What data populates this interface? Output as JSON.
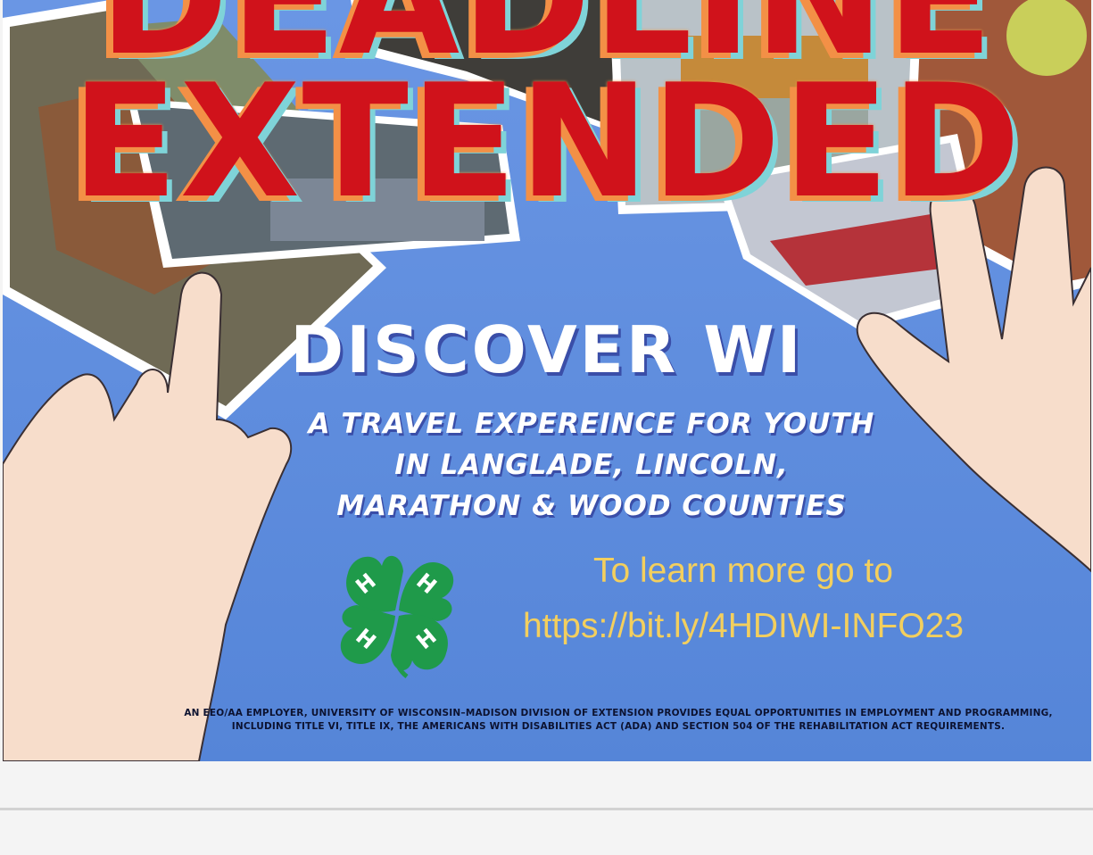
{
  "poster": {
    "headline_line1": "DEADLINE",
    "headline_line2": "EXTENDED",
    "title": "DISCOVER WI",
    "subtitle": "A TRAVEL EXPEREINCE FOR YOUTH IN LANGLADE, LINCOLN, MARATHON & WOOD COUNTIES",
    "cta_line1": "To learn more go to",
    "cta_url": "https://bit.ly/4HDIWI-INFO23",
    "disclaimer": "AN EEO/AA EMPLOYER, UNIVERSITY OF WISCONSIN–MADISON DIVISION OF EXTENSION PROVIDES EQUAL OPPORTUNITIES IN EMPLOYMENT AND PROGRAMMING, INCLUDING TITLE VI, TITLE IX, THE AMERICANS WITH DISABILITIES ACT (ADA) AND SECTION 504 OF THE REHABILITATION ACT REQUIREMENTS.",
    "clover_letter": "H",
    "colors": {
      "background": "#5d8de0",
      "headline": "#d0121b",
      "headline_outline": "#f39046",
      "cta_text": "#f3cf5e",
      "clover": "#1f9a4a"
    }
  }
}
